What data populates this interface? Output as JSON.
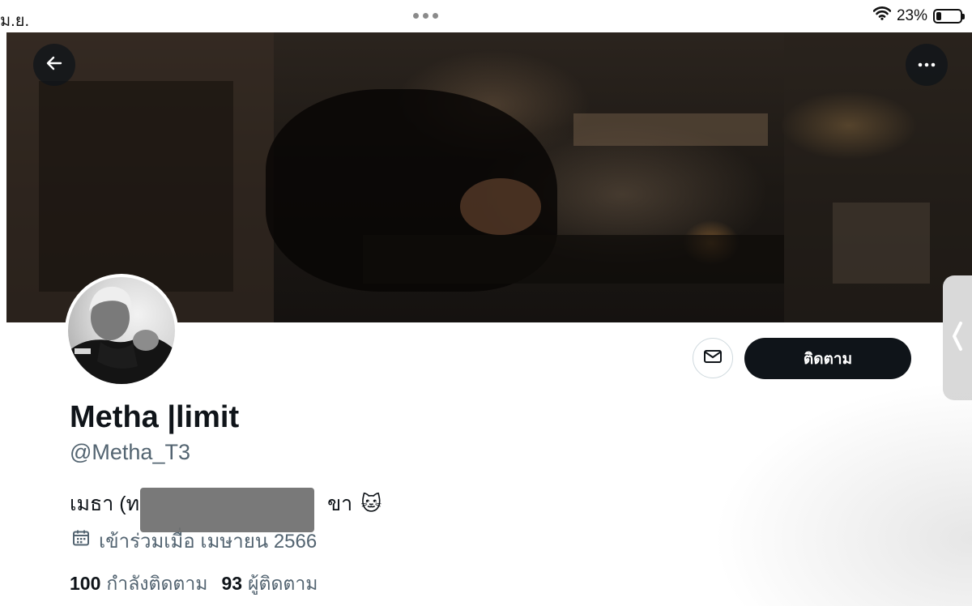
{
  "status_bar": {
    "date_fragment": "ม.ย.",
    "battery": "23%",
    "battery_level": 0.23
  },
  "icons": {
    "back": "arrow-left-icon",
    "more": "more-horizontal-icon",
    "message": "envelope-icon",
    "joined": "calendar-icon",
    "wifi": "wifi-icon",
    "battery": "battery-icon"
  },
  "profile": {
    "display_name": "Metha |limit",
    "handle": "@Metha_T3",
    "bio_start": "เมธา (ท",
    "bio_end": "ขา",
    "bio_emoji": "🐱",
    "joined": "เข้าร่วมเมื่อ เมษายน 2566",
    "following_count": "100",
    "following_label": "กำลังติดตาม",
    "followers_count": "93",
    "followers_label": "ผู้ติดตาม"
  },
  "actions": {
    "follow_label": "ติดตาม"
  },
  "colors": {
    "primary_text": "#0f1419",
    "secondary_text": "#536471",
    "follow_button_bg": "#0f1419"
  }
}
